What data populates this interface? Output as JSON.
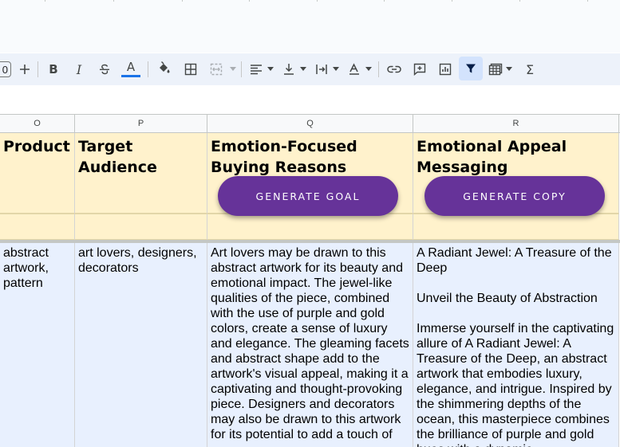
{
  "toolbar": {
    "font_size_value": "0",
    "items": [
      {
        "name": "increase-font-size-icon"
      },
      {
        "name": "bold-icon"
      },
      {
        "name": "italic-icon"
      },
      {
        "name": "strikethrough-icon"
      },
      {
        "name": "text-color-icon",
        "color": "#1a73e8"
      },
      {
        "name": "fill-color-icon"
      },
      {
        "name": "borders-icon"
      },
      {
        "name": "merge-cells-icon"
      },
      {
        "name": "horizontal-align-icon"
      },
      {
        "name": "vertical-align-icon"
      },
      {
        "name": "text-wrapping-icon"
      },
      {
        "name": "text-rotation-icon"
      },
      {
        "name": "insert-link-icon"
      },
      {
        "name": "insert-comment-icon"
      },
      {
        "name": "insert-chart-icon"
      },
      {
        "name": "filter-icon",
        "active": true
      },
      {
        "name": "filter-views-icon"
      },
      {
        "name": "functions-icon"
      }
    ]
  },
  "columns": {
    "o": "O",
    "p": "P",
    "q": "Q",
    "r": "R"
  },
  "headers": {
    "o": "Product",
    "p": "Target Audience",
    "q": "Emotion-Focused Buying Reasons",
    "r": "Emotional Appeal Messaging"
  },
  "buttons": {
    "generate_goal": "GENERATE GOAL",
    "generate_copy": "GENERATE COPY"
  },
  "row1": {
    "product": "abstract artwork, pattern",
    "target_audience": "art lovers, designers, decorators",
    "buying_reasons": "Art lovers may be drawn to this abstract artwork for its beauty and emotional impact. The jewel-like qualities of the piece, combined with the use of purple and gold colors, create a sense of luxury and elegance. The gleaming facets and abstract shape add to the artwork's visual appeal, making it a captivating and thought-provoking piece. Designers and decorators may also be drawn to this artwork for its potential to add a touch of",
    "messaging": "A Radiant Jewel: A Treasure of the Deep\n\nUnveil the Beauty of Abstraction\n\nImmerse yourself in the captivating allure of A Radiant Jewel: A Treasure of the Deep, an abstract artwork that embodies luxury, elegance, and intrigue. Inspired by the shimmering depths of the ocean, this masterpiece combines the brilliance of purple and gold hues with a dynamic"
  },
  "colors": {
    "header_fill": "#fff2cc",
    "data_fill": "#e8f0fe",
    "button": "#663399",
    "toolbar_bg": "#edf2fa"
  }
}
